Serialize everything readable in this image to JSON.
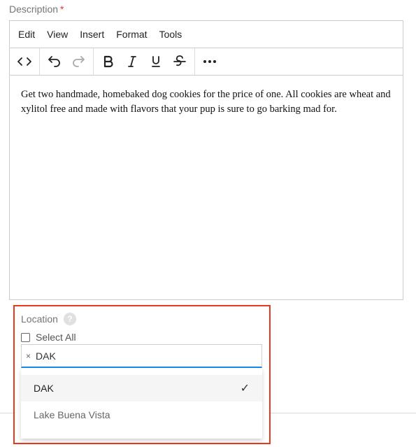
{
  "description": {
    "label": "Description",
    "required_mark": "*",
    "menubar": [
      "Edit",
      "View",
      "Insert",
      "Format",
      "Tools"
    ],
    "toolbar_icons": [
      "code-icon",
      "undo-icon",
      "redo-icon",
      "bold-icon",
      "italic-icon",
      "underline-icon",
      "strikethrough-icon",
      "more-icon"
    ],
    "content": "Get two handmade, homebaked dog cookies for the price of one. All cookies are wheat and xylitol free and made with flavors that your pup is sure to go barking mad for."
  },
  "location": {
    "label": "Location",
    "help": "?",
    "select_all_label": "Select All",
    "select_all_checked": false,
    "tag_remove": "×",
    "selected_tag": "DAK",
    "options": [
      {
        "label": "DAK",
        "selected": true,
        "check": "✓"
      },
      {
        "label": "Lake Buena Vista",
        "selected": false
      }
    ]
  },
  "colors": {
    "highlight_border": "#e8391e",
    "focus_underline": "#1e88e5",
    "required": "#e53935"
  }
}
